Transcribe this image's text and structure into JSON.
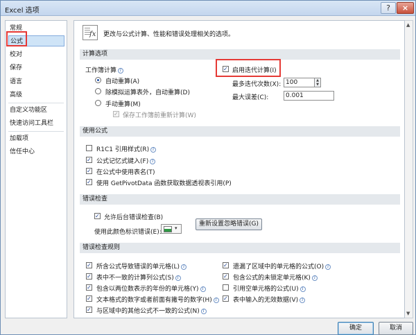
{
  "window": {
    "title": "Excel 选项",
    "help_label": "?",
    "close_label": "×"
  },
  "sidebar": {
    "items": [
      {
        "label": "常规"
      },
      {
        "label": "公式"
      },
      {
        "label": "校对"
      },
      {
        "label": "保存"
      },
      {
        "label": "语言"
      },
      {
        "label": "高级"
      },
      {
        "label": "自定义功能区"
      },
      {
        "label": "快速访问工具栏"
      },
      {
        "label": "加载项"
      },
      {
        "label": "信任中心"
      }
    ],
    "selected": "公式"
  },
  "header": {
    "icon_glyph": "fx",
    "description": "更改与公式计算、性能和错误处理相关的选项。"
  },
  "calc": {
    "section_title": "计算选项",
    "workbook_calc_label": "工作簿计算",
    "radio_auto": "自动重算(A)",
    "radio_auto_except": "除模拟运算表外，自动重算(D)",
    "radio_manual": "手动重算(M)",
    "recalc_before_save": "保存工作簿前重新计算(W)",
    "enable_iterative": "启用迭代计算(I)",
    "max_iterations_label": "最多迭代次数(X):",
    "max_iterations_value": "100",
    "max_change_label": "最大误差(C):",
    "max_change_value": "0.001",
    "info_glyph": "i"
  },
  "formulas": {
    "section_title": "使用公式",
    "r1c1": "R1C1 引用样式(R)",
    "autocomplete": "公式记忆式键入(F)",
    "table_names": "在公式中使用表名(T)",
    "getpivotdata": "使用 GetPivotData 函数获取数据透视表引用(P)"
  },
  "errorcheck": {
    "section_title": "错误检查",
    "enable_bg": "允许后台错误检查(B)",
    "color_label": "使用此颜色标识错误(E):",
    "color_arrow": "▾",
    "reset_button": "重新设置忽略错误(G)"
  },
  "rules": {
    "section_title": "错误检查规则",
    "left": [
      {
        "label": "所含公式导致错误的单元格(L)",
        "checked": true
      },
      {
        "label": "表中不一致的计算列公式(S)",
        "checked": true
      },
      {
        "label": "包含以两位数表示的年份的单元格(Y)",
        "checked": true
      },
      {
        "label": "文本格式的数字或者前面有撇号的数字(H)",
        "checked": true
      },
      {
        "label": "与区域中的其他公式不一致的公式(N)",
        "checked": true
      }
    ],
    "right": [
      {
        "label": "遗漏了区域中的单元格的公式(O)",
        "checked": true
      },
      {
        "label": "包含公式的未锁定单元格(K)",
        "checked": true
      },
      {
        "label": "引用空单元格的公式(U)",
        "checked": false
      },
      {
        "label": "表中输入的无效数据(V)",
        "checked": true
      }
    ]
  },
  "footer": {
    "ok": "确定",
    "cancel": "取消"
  },
  "colors": {
    "highlight_red": "#e53935",
    "selected_nav_bg": "#cfe4f7",
    "section_bg": "#e4e8ec"
  }
}
